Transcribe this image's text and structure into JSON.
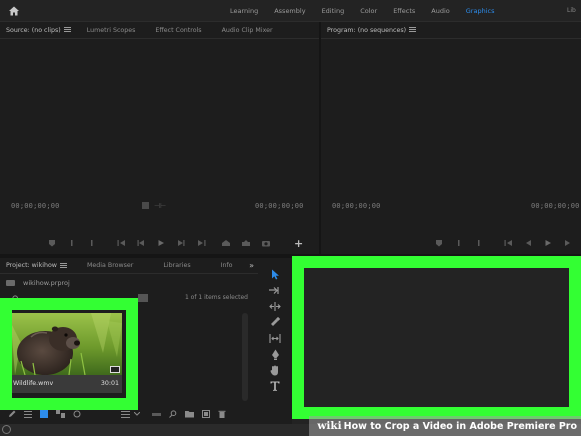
{
  "workspace": {
    "tabs": [
      {
        "label": "Learning"
      },
      {
        "label": "Assembly"
      },
      {
        "label": "Editing"
      },
      {
        "label": "Color"
      },
      {
        "label": "Effects"
      },
      {
        "label": "Audio"
      },
      {
        "label": "Graphics"
      },
      {
        "label": "Lib"
      }
    ],
    "active_tab": "Graphics",
    "accent_color": "#2d8ceb"
  },
  "source_panel": {
    "tabs": [
      {
        "label": "Source: (no clips)"
      },
      {
        "label": "Lumetri Scopes"
      },
      {
        "label": "Effect Controls"
      },
      {
        "label": "Audio Clip Mixer"
      }
    ],
    "timecode_in": "00;00;00;00",
    "timecode_out": "00;00;00;00"
  },
  "program_panel": {
    "title": "Program: (no sequences)",
    "timecode_in": "00;00;00;00",
    "timecode_out": "00;00;00;00"
  },
  "project_panel": {
    "tabs": [
      {
        "label": "Project: wikihow"
      },
      {
        "label": "Media Browser"
      },
      {
        "label": "Libraries"
      },
      {
        "label": "Info"
      }
    ],
    "project_file": "wikihow.prproj",
    "items_selected": "1 of 1 items selected",
    "clip": {
      "name": "Wildlife.wmv",
      "duration": "30:01"
    }
  },
  "tools": [
    "selection-tool",
    "track-select-tool",
    "ripple-edit-tool",
    "razor-tool",
    "slip-tool",
    "pen-tool",
    "hand-tool",
    "type-tool"
  ],
  "highlight_color": "#33ff33",
  "watermark": {
    "brand": "wiki",
    "text": "How to Crop a Video in Adobe Premiere Pro"
  }
}
